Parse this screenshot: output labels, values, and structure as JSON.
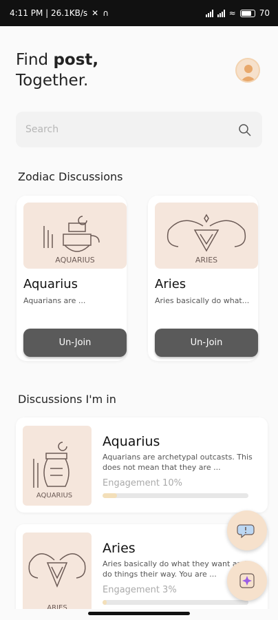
{
  "status_bar": {
    "time_info": "4:11 PM | 26.1KB/s",
    "battery": "70"
  },
  "header": {
    "title_line1_normal": "Find ",
    "title_line1_bold": "post,",
    "title_line2": "Together."
  },
  "search": {
    "placeholder": "Search"
  },
  "zodiac_section": {
    "title": "Zodiac Discussions",
    "cards": [
      {
        "name": "Aquarius",
        "image_label": "AQUARIUS",
        "desc": "Aquarians are ...",
        "button": "Un-Join"
      },
      {
        "name": "Aries",
        "image_label": "ARIES",
        "desc": "Aries basically do what...",
        "button": "Un-Join"
      }
    ]
  },
  "my_section": {
    "title": "Discussions I'm in",
    "items": [
      {
        "name": "Aquarius",
        "image_label": "AQUARIUS",
        "desc": "Aquarians are archetypal outcasts. This does not mean that they are ...",
        "engagement_label": "Engagement 10%",
        "engagement": 0.1
      },
      {
        "name": "Aries",
        "image_label": "ARIES",
        "desc": "Aries basically do what they want and do things their way. You are ...",
        "engagement_label": "Engagement 3%",
        "engagement": 0.03
      }
    ]
  },
  "fabs": {
    "chat_icon": "chat-bubble-icon",
    "add_icon": "sparkle-add-icon"
  },
  "colors": {
    "accent": "#f6e1cc",
    "button": "#5a5a5a",
    "card_image_bg": "#f5e6dc"
  }
}
